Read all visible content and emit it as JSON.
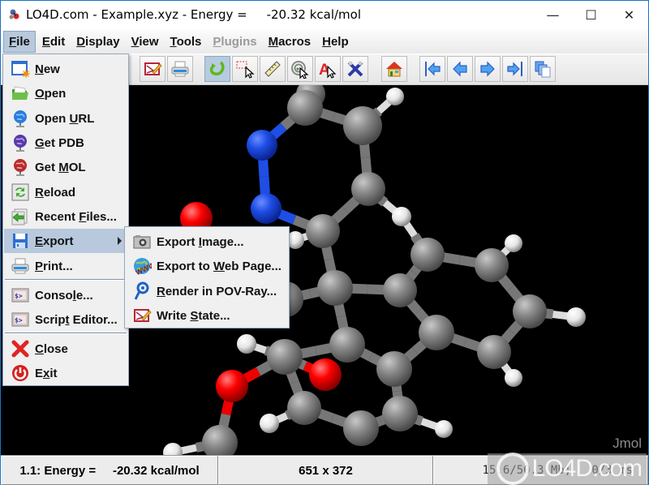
{
  "window": {
    "title": "LO4D.com - Example.xyz - Energy =     -20.32 kcal/mol",
    "controls": {
      "minimize": "—",
      "maximize": "☐",
      "close": "✕"
    }
  },
  "menubar": {
    "items": [
      {
        "label": "File",
        "mnemonic": "F",
        "state": "active"
      },
      {
        "label": "Edit",
        "mnemonic": "E",
        "state": "normal"
      },
      {
        "label": "Display",
        "mnemonic": "D",
        "state": "normal"
      },
      {
        "label": "View",
        "mnemonic": "V",
        "state": "normal"
      },
      {
        "label": "Tools",
        "mnemonic": "T",
        "state": "normal"
      },
      {
        "label": "Plugins",
        "mnemonic": "P",
        "state": "disabled"
      },
      {
        "label": "Macros",
        "mnemonic": "M",
        "state": "normal"
      },
      {
        "label": "Help",
        "mnemonic": "H",
        "state": "normal"
      }
    ]
  },
  "toolbar": {
    "buttons": [
      {
        "icon": "script-editor-icon"
      },
      {
        "icon": "print-icon"
      },
      {
        "icon": "rotate-icon",
        "pressed": true
      },
      {
        "icon": "select-icon"
      },
      {
        "icon": "measure-icon"
      },
      {
        "icon": "spin-pick-icon"
      },
      {
        "icon": "label-pick-icon"
      },
      {
        "icon": "atom-pick-icon"
      },
      {
        "icon": "home-icon"
      },
      {
        "icon": "first-frame-icon"
      },
      {
        "icon": "previous-frame-icon"
      },
      {
        "icon": "next-frame-icon"
      },
      {
        "icon": "last-frame-icon"
      },
      {
        "icon": "all-frames-icon"
      }
    ]
  },
  "file_menu": {
    "items": [
      {
        "label": "New",
        "icon": "new-file-icon"
      },
      {
        "label": "Open",
        "icon": "open-folder-icon"
      },
      {
        "label": "Open URL",
        "icon": "globe-blue-icon"
      },
      {
        "label": "Get PDB",
        "icon": "globe-purple-icon"
      },
      {
        "label": "Get MOL",
        "icon": "globe-red-icon"
      },
      {
        "label": "Reload",
        "icon": "reload-icon"
      },
      {
        "label": "Recent Files...",
        "icon": "recent-files-icon"
      },
      {
        "label": "Export",
        "icon": "save-disk-icon",
        "has_submenu": true,
        "highlighted": true
      },
      {
        "label": "Print...",
        "icon": "print-icon"
      },
      {
        "label": "Console...",
        "icon": "console-icon"
      },
      {
        "label": "Script Editor...",
        "icon": "console-icon"
      },
      {
        "label": "Close",
        "icon": "close-x-icon"
      },
      {
        "label": "Exit",
        "icon": "power-icon"
      }
    ]
  },
  "export_submenu": {
    "items": [
      {
        "label": "Export Image...",
        "icon": "camera-icon"
      },
      {
        "label": "Export to Web Page...",
        "icon": "www-globe-icon"
      },
      {
        "label": "Render in POV-Ray...",
        "icon": "povray-icon"
      },
      {
        "label": "Write State...",
        "icon": "write-state-icon"
      }
    ]
  },
  "viewer": {
    "watermark": "Jmol"
  },
  "statusbar": {
    "energy": "1.1: Energy =     -20.32 kcal/mol",
    "dimensions": "651 x 372",
    "memory": "15.6/50.3 Mb;   0/3 ms"
  },
  "overlay": {
    "watermark_text": "LO4D.com"
  }
}
